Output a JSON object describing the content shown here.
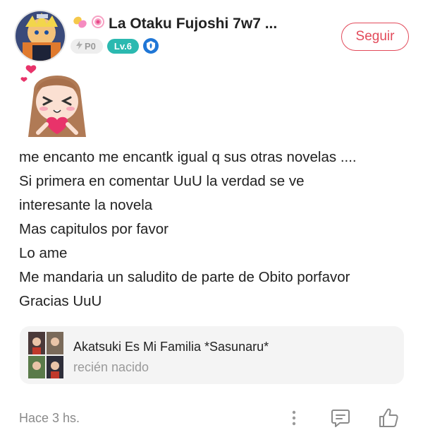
{
  "header": {
    "name": "La Otaku Fujoshi 7w7 ...",
    "name_prefix_icons": [
      "candy-icon",
      "lollipop-icon"
    ],
    "reputation_label": "P0",
    "level_label": "Lv.6",
    "follow_label": "Seguir"
  },
  "post": {
    "lines": [
      "me encanto me encantk igual q sus otras novelas  ....",
      "Si primera en comentar UuU la verdad se ve",
      "interesante la novela",
      "Mas capitulos por favor",
      "Lo ame",
      "Me mandaria un saludito de parte de Obito porfavor",
      "Gracias UuU"
    ]
  },
  "linked_post": {
    "title": "Akatsuki Es Mi Familia *Sasunaru*",
    "subtitle": "recién nacido"
  },
  "footer": {
    "timestamp": "Hace 3 hs."
  },
  "colors": {
    "accent": "#e24a5a",
    "level_badge": "#2bb9b0",
    "shield_badge": "#1f76d6",
    "muted_text": "#8a8a8a",
    "card_bg": "#f4f4f4"
  }
}
